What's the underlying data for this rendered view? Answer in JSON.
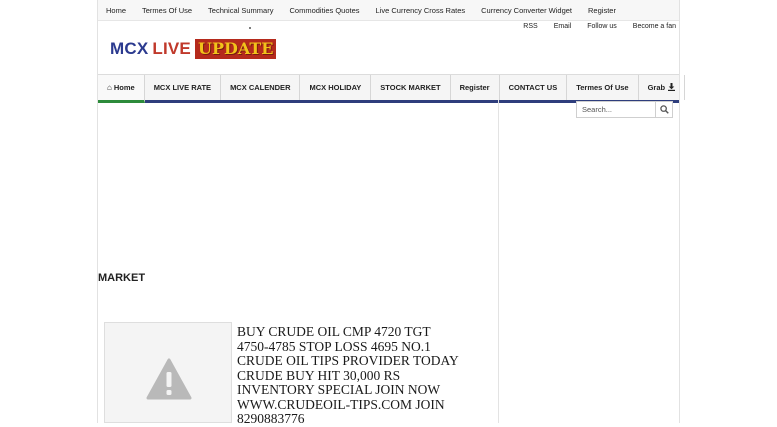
{
  "topbar": {
    "links": [
      "Home",
      "Termes Of Use",
      "Technical Summary",
      "Commodities Quotes",
      "Live Currency Cross Rates",
      "Currency Converter Widget",
      "Register"
    ]
  },
  "toplinks": [
    "RSS",
    "Email",
    "Follow us",
    "Become a fan"
  ],
  "logo": {
    "part1": "MCX",
    "part2": "LIVE",
    "part3": "UPDATE"
  },
  "nav": {
    "items": [
      "Home",
      "MCX LIVE RATE",
      "MCX CALENDER",
      "MCX HOLIDAY",
      "STOCK MARKET",
      "Register",
      "CONTACT US",
      "Termes Of Use",
      "Grab"
    ]
  },
  "search": {
    "placeholder": "Search..."
  },
  "section": {
    "title": "MARKET"
  },
  "post": {
    "title": "BUY CRUDE OIL CMP 4720 TGT 4750-4785 STOP LOSS 4695 No.1 CRUDE OIL TIPS PROVIDER TODAY CRUDE BUY HIT 30,000 RS INVENTORY SPECIAL JOIN NOW WWW.CRUDEOIL-TIPS.COM JOIN 8290883776"
  },
  "colors": {
    "nav_underline": "#2e3d7c",
    "active_tab": "#2d8b3b",
    "logo_blue": "#2b3a8f",
    "logo_red": "#c0392b",
    "logo_yellow": "#f2c21a"
  }
}
